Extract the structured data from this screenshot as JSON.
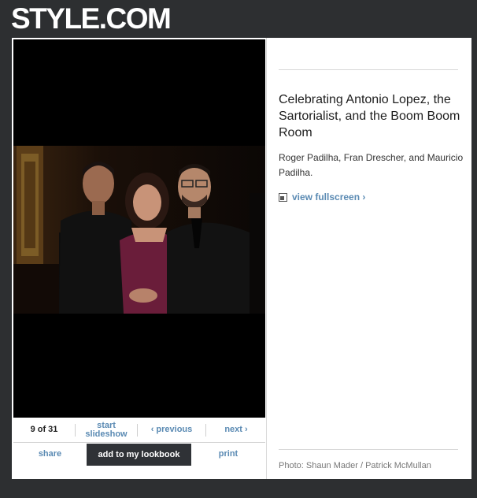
{
  "brand": {
    "logo_text": "STYLE.COM"
  },
  "slideshow": {
    "counter": "9 of 31",
    "start_label": "start slideshow",
    "previous_label": "‹ previous",
    "next_label": "next ›",
    "share_label": "share",
    "lookbook_label": "add to my lookbook",
    "print_label": "print"
  },
  "article": {
    "title": "Celebrating Antonio Lopez, the Sartorialist, and the Boom Boom Room",
    "caption": "Roger Padilha, Fran Drescher, and Mauricio Padilha.",
    "fullscreen_label": "view fullscreen ›",
    "credit": "Photo: Shaun Mader / Patrick McMullan"
  },
  "colors": {
    "page_bg": "#2d2f31",
    "link": "#5a8ab3",
    "lookbook_bg": "#2f3236",
    "dress": "#6a1d3a"
  }
}
